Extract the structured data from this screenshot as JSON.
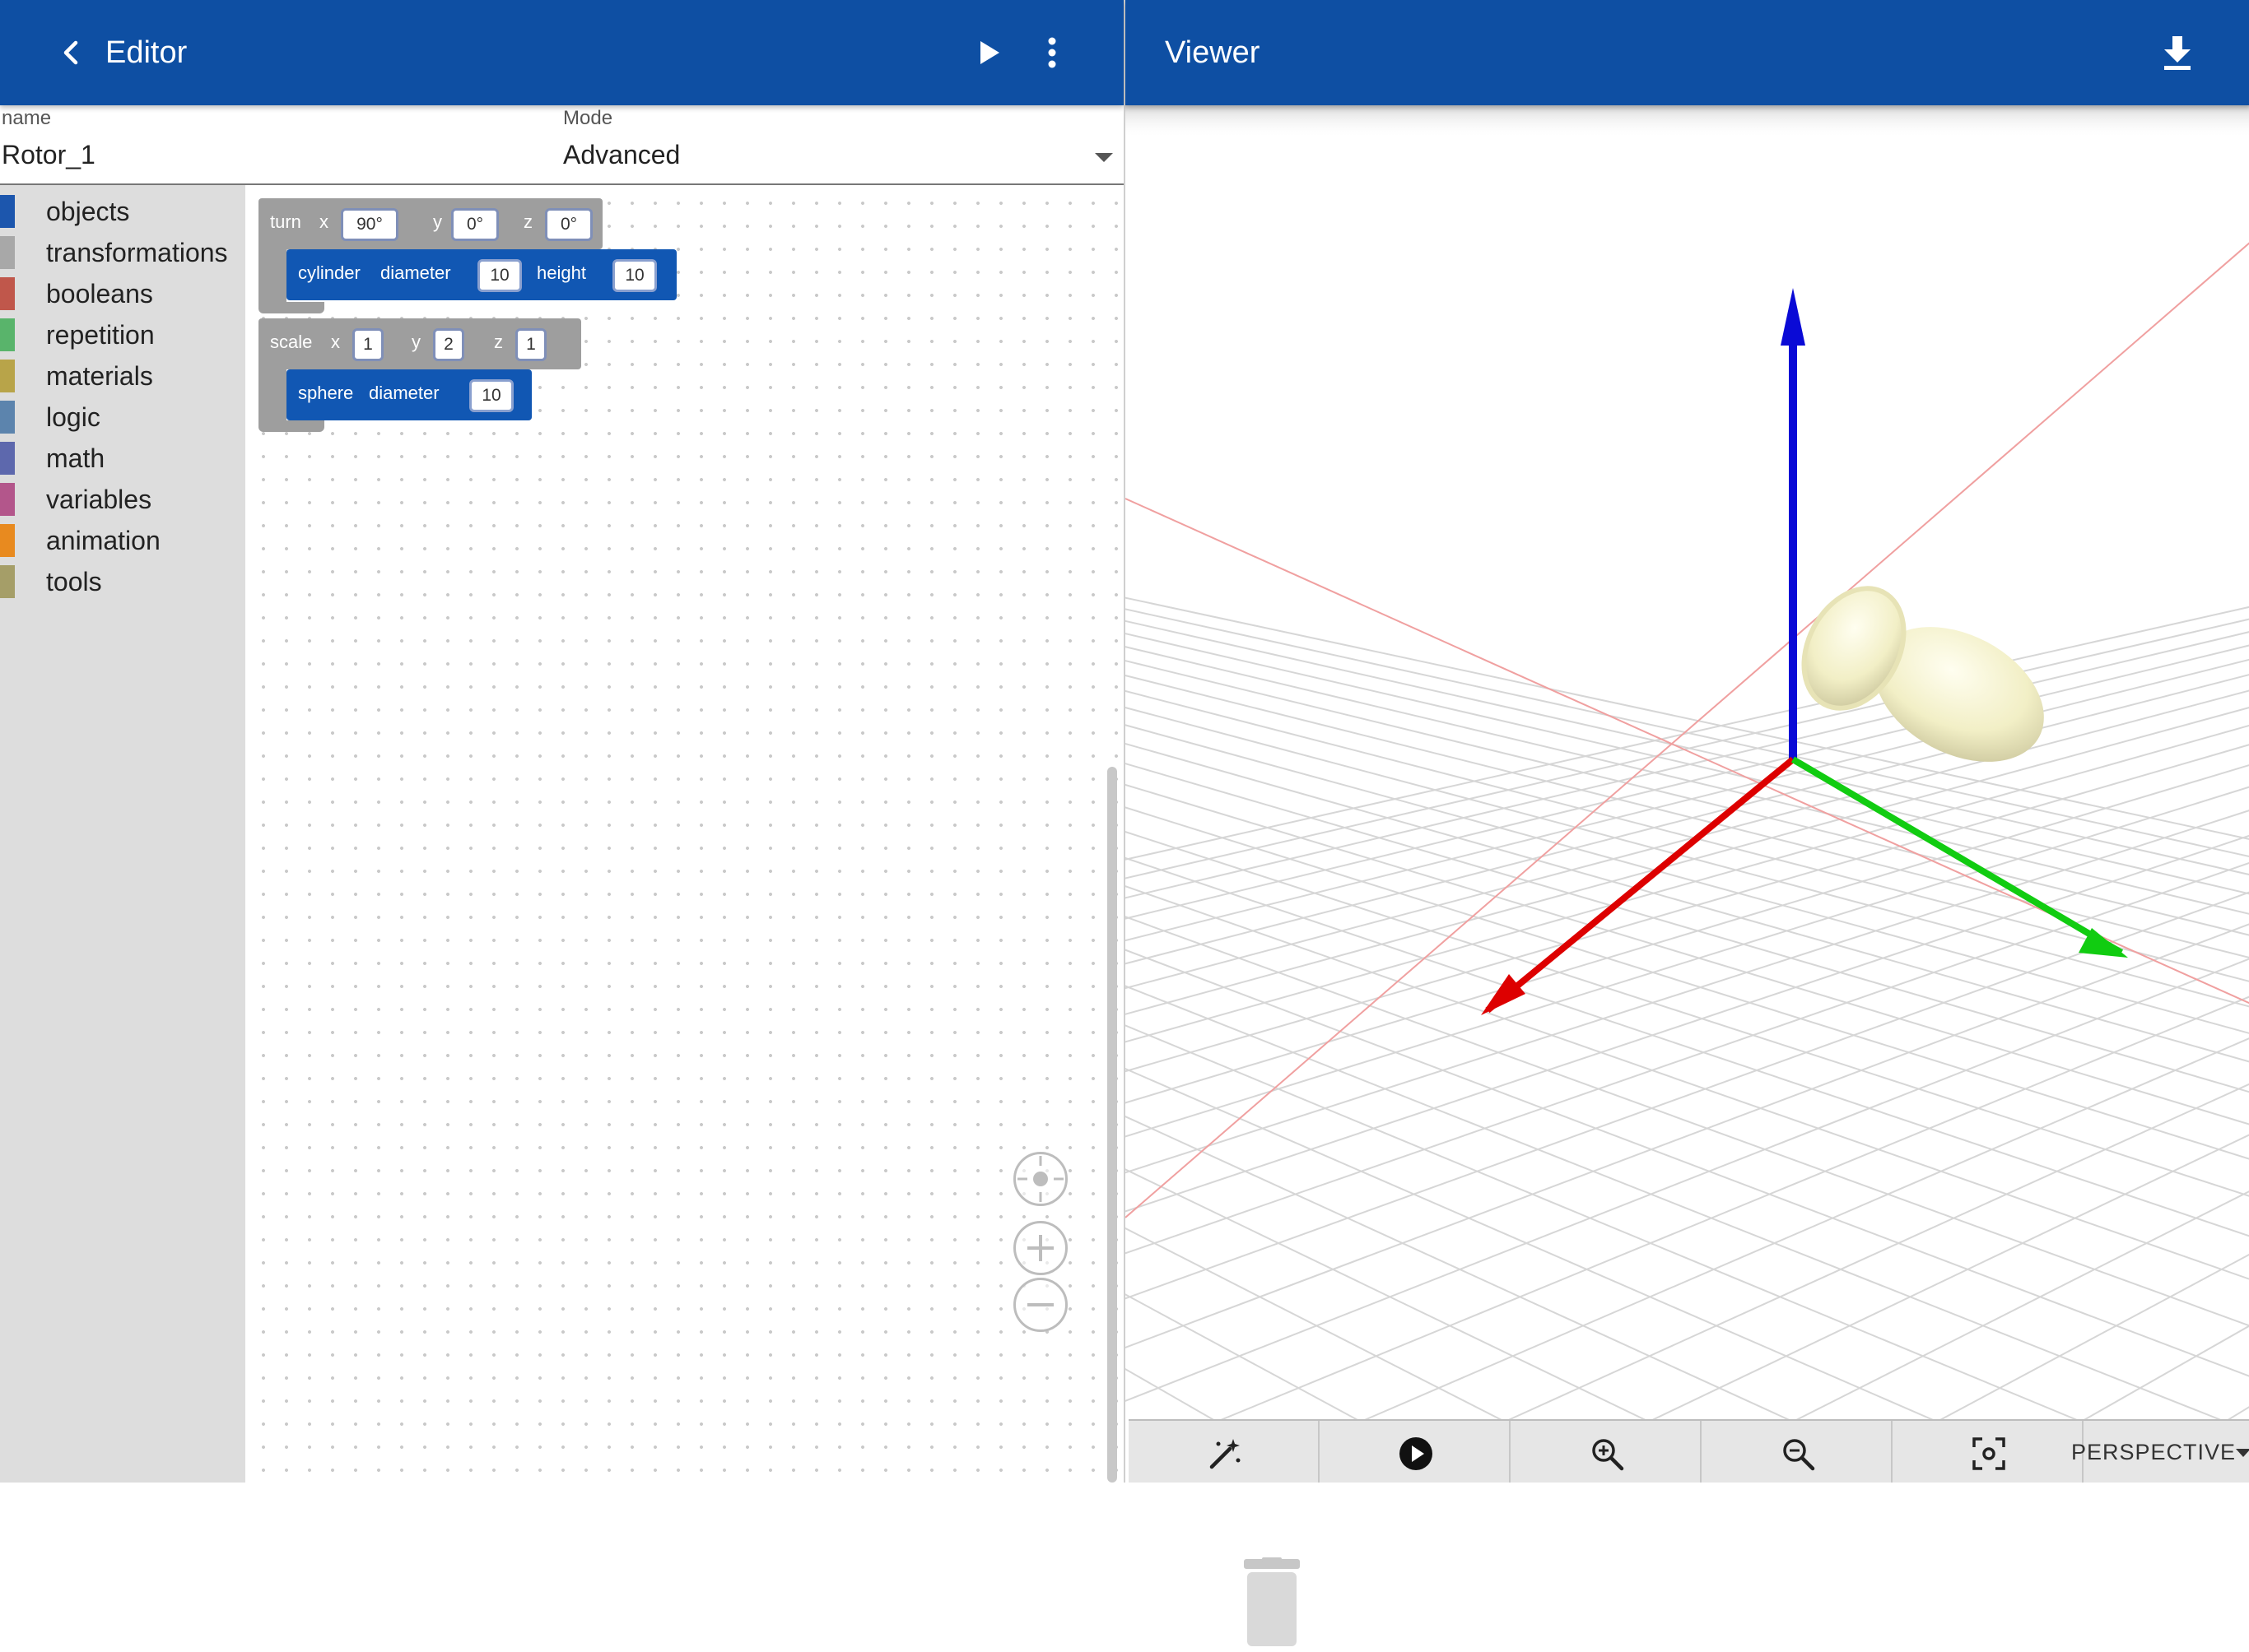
{
  "editor": {
    "title": "Editor",
    "name_label": "name",
    "name_value": "Rotor_1",
    "mode_label": "Mode",
    "mode_value": "Advanced"
  },
  "toolbox": {
    "categories": [
      {
        "label": "objects",
        "color": "#1c56ad"
      },
      {
        "label": "transformations",
        "color": "#a8a8a8"
      },
      {
        "label": "booleans",
        "color": "#c0574b"
      },
      {
        "label": "repetition",
        "color": "#59b46b"
      },
      {
        "label": "materials",
        "color": "#b8a449"
      },
      {
        "label": "logic",
        "color": "#5c84ad"
      },
      {
        "label": "math",
        "color": "#5d68ad"
      },
      {
        "label": "variables",
        "color": "#b3568b"
      },
      {
        "label": "animation",
        "color": "#e88a1f"
      },
      {
        "label": "tools",
        "color": "#a59e68"
      }
    ]
  },
  "blocks": {
    "turn": {
      "label": "turn",
      "x_label": "x",
      "x": "90°",
      "y_label": "y",
      "y": "0°",
      "z_label": "z",
      "z": "0°"
    },
    "cylinder": {
      "label": "cylinder",
      "diameter_label": "diameter",
      "diameter": "10",
      "height_label": "height",
      "height": "10"
    },
    "scale": {
      "label": "scale",
      "x_label": "x",
      "x": "1",
      "y_label": "y",
      "y": "2",
      "z_label": "z",
      "z": "1"
    },
    "sphere": {
      "label": "sphere",
      "diameter_label": "diameter",
      "diameter": "10"
    }
  },
  "viewer": {
    "title": "Viewer",
    "projection": "PERSPECTIVE"
  },
  "colors": {
    "appbar": "#0e4fa3",
    "x_axis": "#dd0000",
    "y_axis": "#11cc11",
    "z_axis": "#0000dd",
    "model": "#f4f1c9"
  }
}
